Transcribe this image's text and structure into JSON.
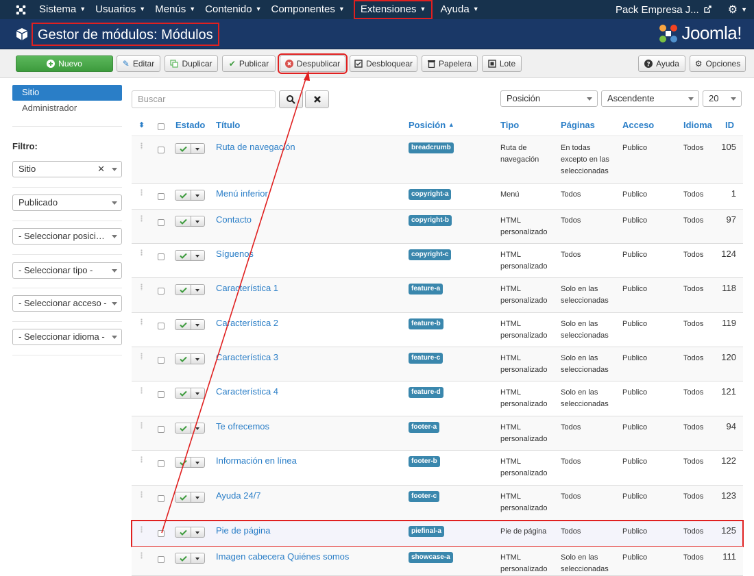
{
  "topnav": {
    "items": [
      {
        "label": "Sistema"
      },
      {
        "label": "Usuarios"
      },
      {
        "label": "Menús"
      },
      {
        "label": "Contenido"
      },
      {
        "label": "Componentes"
      },
      {
        "label": "Extensiones"
      },
      {
        "label": "Ayuda"
      }
    ],
    "site_name": "Pack Empresa J...",
    "icons": [
      "joomla-icon",
      "external-link-icon",
      "gear-icon"
    ]
  },
  "header": {
    "title": "Gestor de módulos: Módulos",
    "brand": "Joomla!"
  },
  "toolbar": {
    "nuevo": "Nuevo",
    "editar": "Editar",
    "duplicar": "Duplicar",
    "publicar": "Publicar",
    "despublicar": "Despublicar",
    "desbloquear": "Desbloquear",
    "papelera": "Papelera",
    "lote": "Lote",
    "ayuda": "Ayuda",
    "opciones": "Opciones"
  },
  "sidebar": {
    "items": [
      "Sitio",
      "Administrador"
    ],
    "filter_label": "Filtro:",
    "filters": [
      "Sitio",
      "Publicado",
      "- Seleccionar posici…",
      "- Seleccionar tipo -",
      "- Seleccionar acceso -",
      "- Seleccionar idioma -"
    ]
  },
  "search": {
    "placeholder": "Buscar",
    "sort_field": "Posición",
    "sort_dir": "Ascendente",
    "limit": "20"
  },
  "table": {
    "headers": {
      "estado": "Estado",
      "titulo": "Título",
      "posicion": "Posición",
      "tipo": "Tipo",
      "paginas": "Páginas",
      "acceso": "Acceso",
      "idioma": "Idioma",
      "id": "ID"
    },
    "rows": [
      {
        "title": "Ruta de navegación",
        "position": "breadcrumb",
        "type1": "Ruta de",
        "type2": "navegación",
        "pages1": "En todas",
        "pages2": "excepto en las",
        "pages3": "seleccionadas",
        "access": "Publico",
        "lang": "Todos",
        "id": "105"
      },
      {
        "title": "Menú inferior",
        "position": "copyright-a",
        "type1": "Menú",
        "type2": "",
        "pages1": "Todos",
        "pages2": "",
        "pages3": "",
        "access": "Publico",
        "lang": "Todos",
        "id": "1"
      },
      {
        "title": "Contacto",
        "position": "copyright-b",
        "type1": "HTML",
        "type2": "personalizado",
        "pages1": "Todos",
        "pages2": "",
        "pages3": "",
        "access": "Publico",
        "lang": "Todos",
        "id": "97"
      },
      {
        "title": "Síguenos",
        "position": "copyright-c",
        "type1": "HTML",
        "type2": "personalizado",
        "pages1": "Todos",
        "pages2": "",
        "pages3": "",
        "access": "Publico",
        "lang": "Todos",
        "id": "124"
      },
      {
        "title": "Característica 1",
        "position": "feature-a",
        "type1": "HTML",
        "type2": "personalizado",
        "pages1": "Solo en las",
        "pages2": "seleccionadas",
        "pages3": "",
        "access": "Publico",
        "lang": "Todos",
        "id": "118"
      },
      {
        "title": "Característica 2",
        "position": "feature-b",
        "type1": "HTML",
        "type2": "personalizado",
        "pages1": "Solo en las",
        "pages2": "seleccionadas",
        "pages3": "",
        "access": "Publico",
        "lang": "Todos",
        "id": "119"
      },
      {
        "title": "Característica 3",
        "position": "feature-c",
        "type1": "HTML",
        "type2": "personalizado",
        "pages1": "Solo en las",
        "pages2": "seleccionadas",
        "pages3": "",
        "access": "Publico",
        "lang": "Todos",
        "id": "120"
      },
      {
        "title": "Característica 4",
        "position": "feature-d",
        "type1": "HTML",
        "type2": "personalizado",
        "pages1": "Solo en las",
        "pages2": "seleccionadas",
        "pages3": "",
        "access": "Publico",
        "lang": "Todos",
        "id": "121"
      },
      {
        "title": "Te ofrecemos",
        "position": "footer-a",
        "type1": "HTML",
        "type2": "personalizado",
        "pages1": "Todos",
        "pages2": "",
        "pages3": "",
        "access": "Publico",
        "lang": "Todos",
        "id": "94"
      },
      {
        "title": "Información en línea",
        "position": "footer-b",
        "type1": "HTML",
        "type2": "personalizado",
        "pages1": "Todos",
        "pages2": "",
        "pages3": "",
        "access": "Publico",
        "lang": "Todos",
        "id": "122"
      },
      {
        "title": "Ayuda 24/7",
        "position": "footer-c",
        "type1": "HTML",
        "type2": "personalizado",
        "pages1": "Todos",
        "pages2": "",
        "pages3": "",
        "access": "Publico",
        "lang": "Todos",
        "id": "123"
      },
      {
        "title": "Pie de página",
        "position": "piefinal-a",
        "type1": "Pie de página",
        "type2": "",
        "pages1": "Todos",
        "pages2": "",
        "pages3": "",
        "access": "Publico",
        "lang": "Todos",
        "id": "125"
      },
      {
        "title": "Imagen cabecera Quiénes somos",
        "position": "showcase-a",
        "type1": "HTML",
        "type2": "personalizado",
        "pages1": "Solo en las",
        "pages2": "seleccionadas",
        "pages3": "",
        "access": "Publico",
        "lang": "Todos",
        "id": "111"
      }
    ]
  },
  "colors": {
    "nav_bg": "#17324d",
    "header_bg": "#1a3867",
    "link": "#2a7ec7",
    "badge": "#3a87ad",
    "annotation": "#e02020",
    "success": "#5cb85c"
  }
}
